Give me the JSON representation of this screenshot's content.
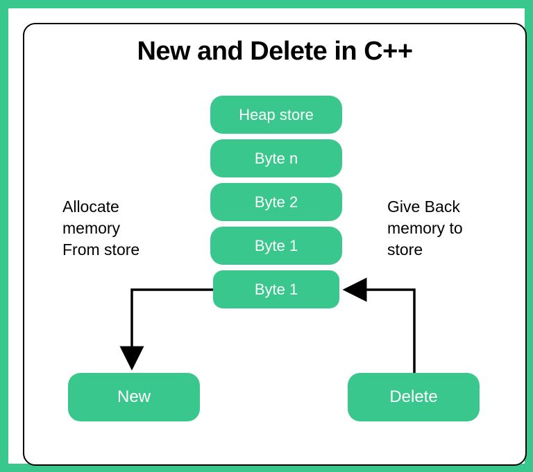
{
  "title": "New and Delete in C++",
  "stack": {
    "heap_store": "Heap store",
    "byte_n": "Byte n",
    "byte_2": "Byte 2",
    "byte_1a": "Byte 1",
    "byte_1b": "Byte 1"
  },
  "operations": {
    "new_label": "New",
    "delete_label": "Delete"
  },
  "annotations": {
    "allocate": "Allocate\nmemory\nFrom store",
    "giveback": "Give Back\nmemory to\nstore"
  },
  "colors": {
    "accent": "#39c78d"
  }
}
